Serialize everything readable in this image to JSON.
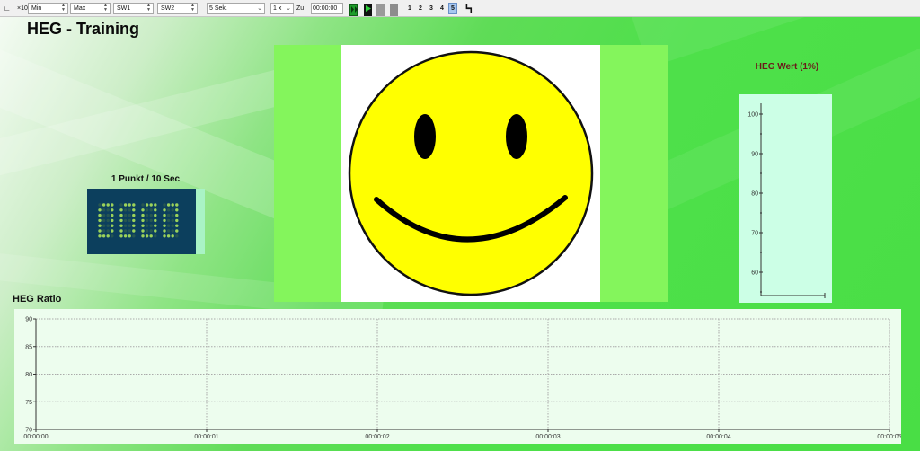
{
  "toolbar": {
    "zoom_label": "×10",
    "min_label": "Min",
    "max_label": "Max",
    "sw1_label": "SW1",
    "sw2_label": "SW2",
    "interval_value": "5 Sek.",
    "speed_value": "1 x",
    "zu_label": "Zu",
    "time_value": "00:00:00",
    "tab_numbers": [
      "1",
      "2",
      "3",
      "4",
      "5"
    ],
    "active_tab": "5",
    "colors": {
      "record": "#1f9d2b",
      "play": "#1f9d2b",
      "pause": "#9a9a9a",
      "stop": "#9a9a9a"
    }
  },
  "header": {
    "title": "HEG - Training"
  },
  "counter": {
    "title": "1 Punkt / 10 Sec",
    "digits": "0000",
    "digit_color": "#9bd25a"
  },
  "feedback": {
    "face": "smiley",
    "face_color": "#ffff00"
  },
  "heg_wert": {
    "title": "HEG Wert (1%)",
    "y_ticks": [
      "100",
      "90",
      "80",
      "70",
      "60"
    ],
    "y_values": [
      100,
      90,
      80,
      70,
      60
    ]
  },
  "heg_ratio": {
    "title": "HEG Ratio",
    "y_ticks": [
      "90",
      "85",
      "80",
      "75",
      "70"
    ],
    "y_values": [
      90,
      85,
      80,
      75,
      70
    ],
    "x_ticks": [
      "00:00:00",
      "00:00:01",
      "00:00:02",
      "00:00:03",
      "00:00:04",
      "00:00:05"
    ]
  }
}
